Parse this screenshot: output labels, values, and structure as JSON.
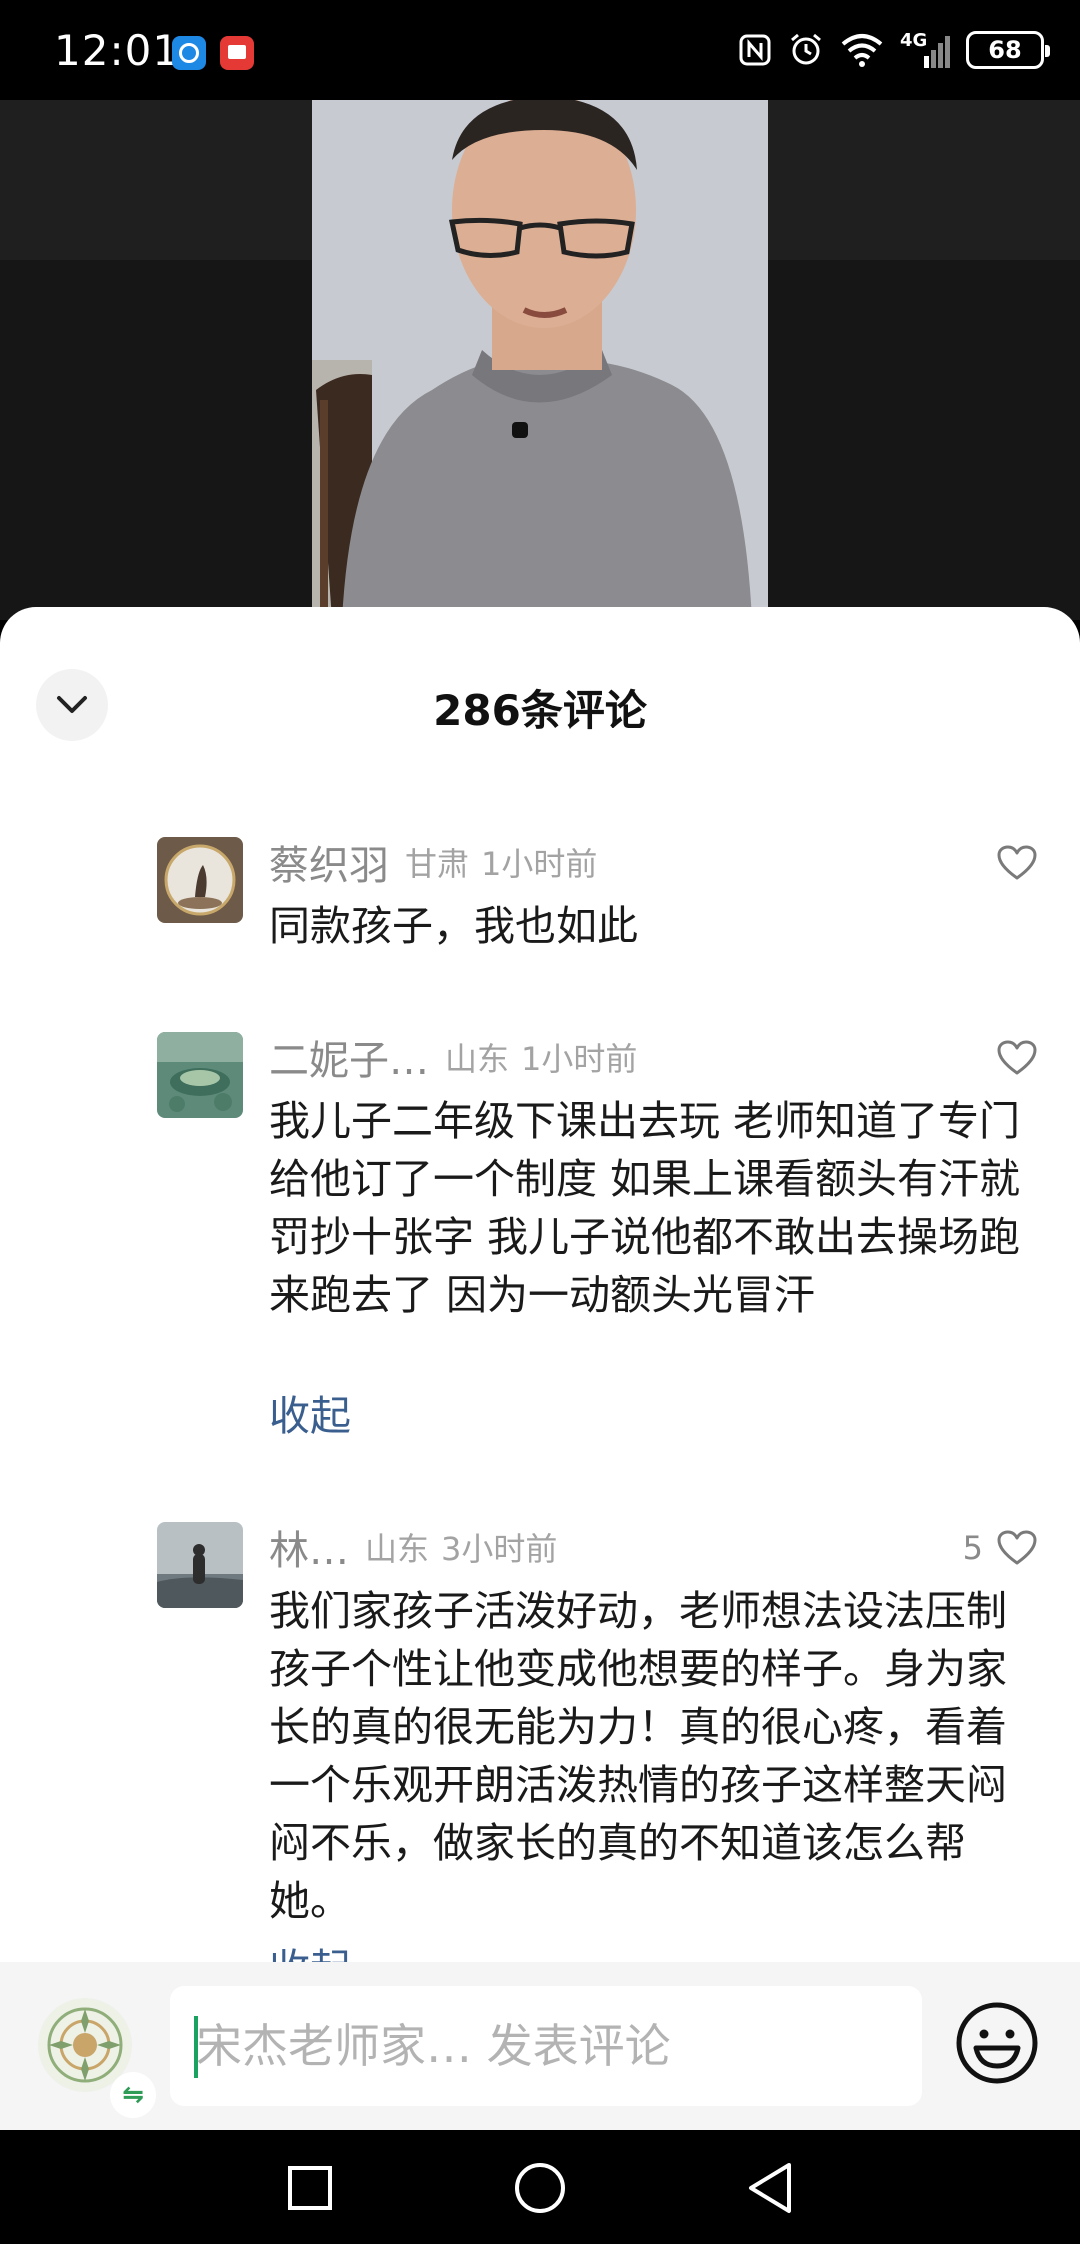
{
  "status_bar": {
    "time": "12:01",
    "network": "4G",
    "battery": "68"
  },
  "sheet": {
    "title": "286条评论"
  },
  "comments": [
    {
      "name": "蔡织羽",
      "region": "甘肃",
      "time": "1小时前",
      "text": "同款孩子，我也如此",
      "likes": ""
    },
    {
      "name": "二妮子…",
      "region": "山东",
      "time": "1小时前",
      "text": "我儿子二年级下课出去玩 老师知道了专门给他订了一个制度 如果上课看额头有汗就罚抄十张字 我儿子说他都不敢出去操场跑来跑去了 因为一动额头光冒汗",
      "fold_label": "收起",
      "likes": ""
    },
    {
      "name": "林…",
      "region": "山东",
      "time": "3小时前",
      "text": "我们家孩子活泼好动，老师想法设法压制孩子个性让他变成他想要的样子。身为家长的真的很无能为力！真的很心疼，看着一个乐观开朗活泼热情的孩子这样整天闷闷不乐，做家长的真的不知道该怎么帮她。",
      "fold_label": "收起",
      "likes": "5"
    }
  ],
  "input_bar": {
    "placeholder": "宋杰老师家… 发表评论",
    "swap_icon": "⇋"
  },
  "icons": {
    "collapse": "chevron-down-icon",
    "like": "heart-outline-icon",
    "emoji": "smiley-icon",
    "nav_recent": "square-icon",
    "nav_home": "circle-icon",
    "nav_back": "triangle-back-icon"
  },
  "colors": {
    "accent_caret": "#1aa260",
    "fold_link": "#3a5f8f",
    "sheet_bg": "#ffffff"
  }
}
